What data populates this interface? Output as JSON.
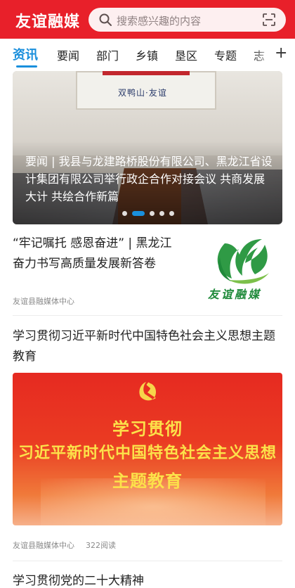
{
  "header": {
    "app_title": "友谊融媒",
    "search_placeholder": "搜索感兴趣的内容",
    "search_icon": "search-icon",
    "scan_icon": "scan-icon"
  },
  "tabs": [
    {
      "label": "资讯",
      "active": true
    },
    {
      "label": "要闻",
      "active": false
    },
    {
      "label": "部门",
      "active": false
    },
    {
      "label": "乡镇",
      "active": false
    },
    {
      "label": "垦区",
      "active": false
    },
    {
      "label": "专题",
      "active": false
    },
    {
      "label": "志",
      "active": false
    }
  ],
  "tab_add_label": "+",
  "banner": {
    "photo_sign": "双鸭山·友谊",
    "caption": "要闻 | 我县与龙建路桥股份有限公司、黑龙江省设计集团有限公司举行政企合作对接会议 共商发展大计 共绘合作新篇",
    "slide_count": 5,
    "active_slide": 2
  },
  "articles": [
    {
      "title": "“牢记嘱托 感恩奋进” | 黑龙江奋力书写高质量发展新答卷",
      "source": "友谊县融媒体中心",
      "thumb_logo_text": "友谊融媒"
    },
    {
      "title": "学习贯彻习近平新时代中国特色社会主义思想主题教育",
      "poster_lines": [
        "学习贯彻",
        "习近平新时代中国特色社会主义思想",
        "主题教育"
      ],
      "source": "友谊县融媒体中心",
      "reads": "322阅读"
    },
    {
      "title": "学习贯彻党的二十大精神"
    }
  ],
  "colors": {
    "brand_red": "#e8202a",
    "accent_blue": "#1a8fdc",
    "logo_green": "#1f8a3a",
    "poster_yellow": "#fce24a"
  }
}
